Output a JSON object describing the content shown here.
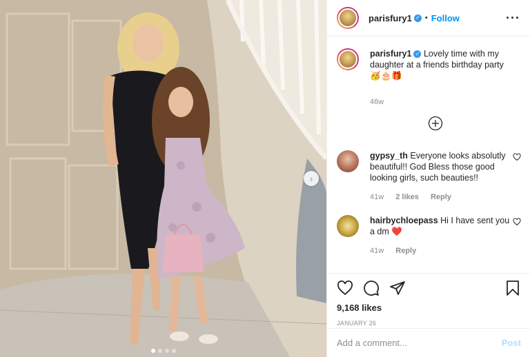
{
  "post": {
    "author": "parisfury1",
    "verified": true,
    "follow_label": "Follow",
    "separator": "•",
    "more_icon": "more-options-icon",
    "caption": "Lovely time with my daughter at a friends birthday party 🥳🎂🎁",
    "caption_age": "46w",
    "carousel": {
      "count": 4,
      "active": 0
    },
    "likes": "9,168 likes",
    "date": "JANUARY 26"
  },
  "comments": [
    {
      "user": "gypsy_th",
      "text": "Everyone looks absolutly beautiful!! God Bless those good looking girls, such beauties!!",
      "age": "41w",
      "likes": "2 likes",
      "reply": "Reply"
    },
    {
      "user": "hairbychloepass",
      "text": "Hi I have sent you a dm ❤️",
      "age": "41w",
      "reply": "Reply"
    }
  ],
  "add_comment": {
    "placeholder": "Add a comment...",
    "post_label": "Post"
  },
  "colors": {
    "link": "#0095f6",
    "muted": "#8e8e8e",
    "border": "#efefef",
    "post_disabled": "#b2dffc"
  }
}
